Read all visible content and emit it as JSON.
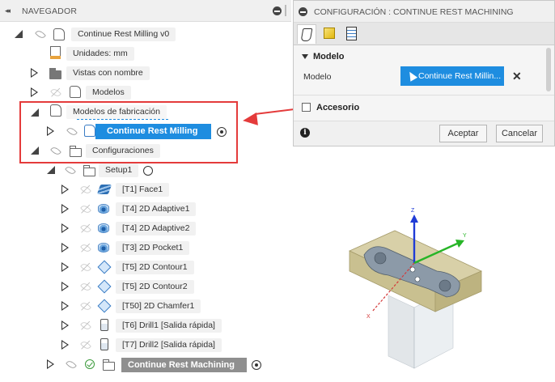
{
  "browser": {
    "collapse_glyph": "◂◂",
    "title": "NAVEGADOR",
    "root": "Continue Rest Milling v0",
    "units": "Unidades: mm",
    "named_views": "Vistas con nombre",
    "models": "Modelos",
    "manufacturing_models": "Modelos de fabricación",
    "selected_model": "Continue Rest Milling",
    "setups": "Configuraciones",
    "setup1": "Setup1",
    "operations": [
      "[T1] Face1",
      "[T4] 2D Adaptive1",
      "[T4] 2D Adaptive2",
      "[T3] 2D Pocket1",
      "[T5] 2D Contour1",
      "[T5] 2D Contour2",
      "[T50] 2D Chamfer1",
      "[T6] Drill1 [Salida rápida]",
      "[T7] Drill2 [Salida rápida]"
    ],
    "last_setup": "Continue Rest Machining"
  },
  "dialog": {
    "title": "CONFIGURACIÓN : CONTINUE REST MACHINING",
    "section_model": "Modelo",
    "field_model": "Modelo",
    "model_value": "Continue Rest Millin...",
    "clear_glyph": "✕",
    "section_accessory": "Accesorio",
    "info_glyph": "i",
    "accept": "Aceptar",
    "cancel": "Cancelar"
  },
  "viewport": {
    "axis_z": "Z",
    "axis_y": "Y",
    "axis_x": "X"
  },
  "colors": {
    "selection_blue": "#1e8de0",
    "annotation_red": "#e43b3b",
    "stock_tan": "#d8d0a8"
  }
}
